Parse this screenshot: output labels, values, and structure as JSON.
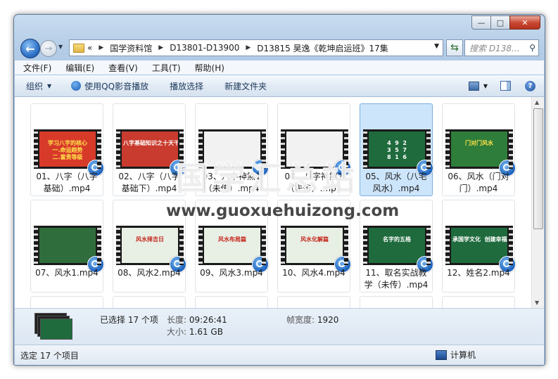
{
  "window": {
    "controls": [
      "—",
      "□",
      "✕"
    ]
  },
  "nav": {
    "address_prefix": "«",
    "breadcrumbs": [
      "国学资料馆",
      "D13801-D13900",
      "D13815 昊逸《乾坤启运班》17集"
    ],
    "search_placeholder": "搜索 D138..."
  },
  "menubar": [
    "文件(F)",
    "编辑(E)",
    "查看(V)",
    "工具(T)",
    "帮助(H)"
  ],
  "toolbar": {
    "organize": "组织",
    "play_with_qq": "使用QQ影音播放",
    "play_selection": "播放选择",
    "new_folder": "新建文件夹",
    "help": "?"
  },
  "files": [
    {
      "name": "01、八字（八字基础）.mp4",
      "bg": "#d83a2a",
      "fg": "#ffe24a",
      "text": "学习八字的核心\n一.命运趋势\n二.富贵等级"
    },
    {
      "name": "02、八字（八字基础下）.mp4",
      "bg": "#c93b2e",
      "fg": "#ffffff",
      "text": "八字基础知识之十天干"
    },
    {
      "name": "03、八字神煞1（未传）.mp4",
      "bg": "#f2f2f2",
      "fg": "#444444",
      "text": ""
    },
    {
      "name": "04、八字神煞2（未传）.mp4",
      "bg": "#f2f2f2",
      "fg": "#444444",
      "text": ""
    },
    {
      "name": "05、风水（八宅风水）.mp4",
      "bg": "#1f6b3d",
      "fg": "#ffffff",
      "text": "4  9  2\n3  5  7\n8  1  6",
      "selected": true
    },
    {
      "name": "06、风水（门对门）.mp4",
      "bg": "#2e7d3a",
      "fg": "#ffe24a",
      "text": "门对门风水"
    },
    {
      "name": "07、风水1.mp4",
      "bg": "#2f6e3c",
      "fg": "#ffffff",
      "text": ""
    },
    {
      "name": "08、风水2.mp4",
      "bg": "#e8efe4",
      "fg": "#c4261d",
      "text": "风水择吉日"
    },
    {
      "name": "09、风水3.mp4",
      "bg": "#e8efe4",
      "fg": "#c4261d",
      "text": "风水布局篇"
    },
    {
      "name": "10、风水4.mp4",
      "bg": "#e8efe4",
      "fg": "#c4261d",
      "text": "风水化解篇"
    },
    {
      "name": "11、取名实战教学（未传）.mp4",
      "bg": "#1f6b3d",
      "fg": "#ffffff",
      "text": "名字的五格"
    },
    {
      "name": "12、姓名2.mp4",
      "bg": "#1f6b3d",
      "fg": "#ffffff",
      "text": "承国学文化  创建幸福人生"
    }
  ],
  "watermark": {
    "title": "国学汇总站",
    "url": "www.guoxuehuizong.com"
  },
  "details": {
    "selected": "已选择 17 个项",
    "length_label": "长度:",
    "length_value": "09:26:41",
    "size_label": "大小:",
    "size_value": "1.61 GB",
    "width_label": "帧宽度:",
    "width_value": "1920"
  },
  "status": {
    "left": "选定 17 个项目",
    "right": "计算机"
  },
  "colors": {
    "selection": "#cde5fb",
    "accent": "#2167c2"
  }
}
